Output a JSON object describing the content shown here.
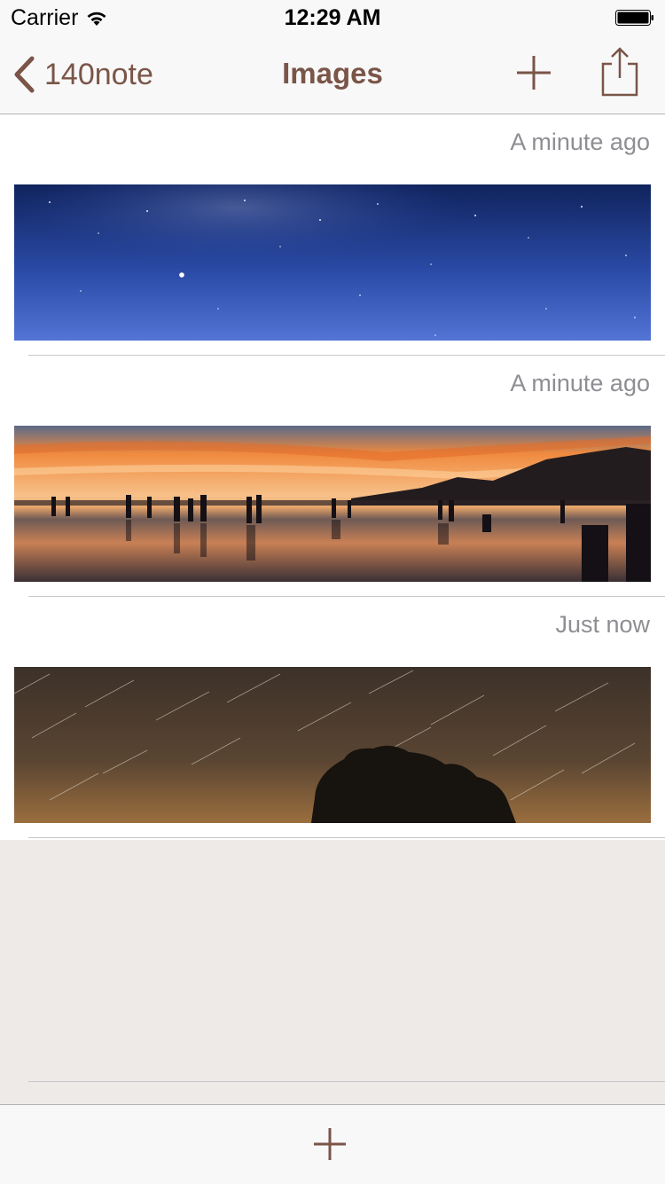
{
  "status_bar": {
    "carrier": "Carrier",
    "time": "12:29 AM"
  },
  "nav": {
    "back_label": "140note",
    "title": "Images"
  },
  "notes": [
    {
      "timestamp": "A minute ago",
      "image": "starry-night-sky-panorama"
    },
    {
      "timestamp": "A minute ago",
      "image": "sunset-salt-flat-silhouettes"
    },
    {
      "timestamp": "Just now",
      "image": "star-trails-over-tree"
    }
  ],
  "icons": {
    "back": "chevron-left-icon",
    "add": "plus-icon",
    "share": "share-icon",
    "toolbar_add": "plus-icon"
  },
  "colors": {
    "accent": "#7a5548",
    "timestamp": "#8e8e93",
    "empty_background": "#eeeae7",
    "bar_background": "#f8f8f8"
  }
}
